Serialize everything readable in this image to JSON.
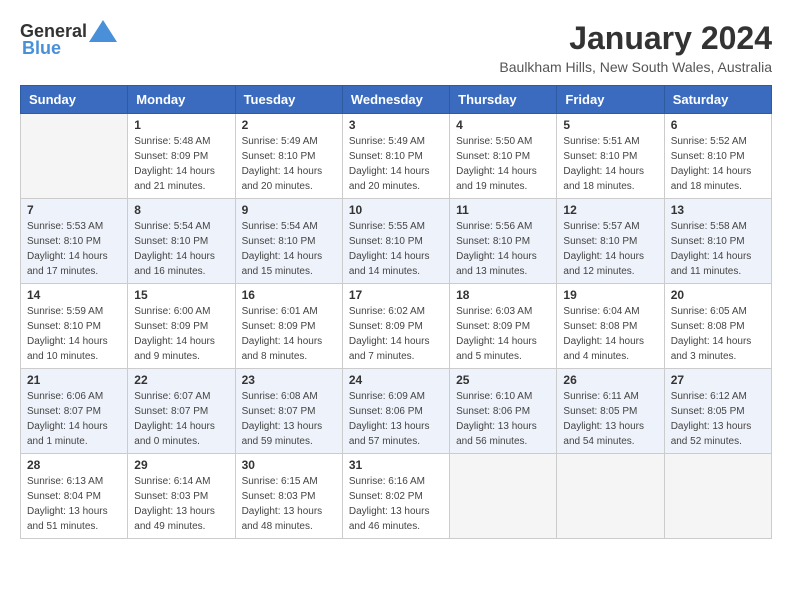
{
  "header": {
    "logo_general": "General",
    "logo_blue": "Blue",
    "month_title": "January 2024",
    "location": "Baulkham Hills, New South Wales, Australia"
  },
  "weekdays": [
    "Sunday",
    "Monday",
    "Tuesday",
    "Wednesday",
    "Thursday",
    "Friday",
    "Saturday"
  ],
  "weeks": [
    [
      {
        "day": "",
        "info": ""
      },
      {
        "day": "1",
        "info": "Sunrise: 5:48 AM\nSunset: 8:09 PM\nDaylight: 14 hours\nand 21 minutes."
      },
      {
        "day": "2",
        "info": "Sunrise: 5:49 AM\nSunset: 8:10 PM\nDaylight: 14 hours\nand 20 minutes."
      },
      {
        "day": "3",
        "info": "Sunrise: 5:49 AM\nSunset: 8:10 PM\nDaylight: 14 hours\nand 20 minutes."
      },
      {
        "day": "4",
        "info": "Sunrise: 5:50 AM\nSunset: 8:10 PM\nDaylight: 14 hours\nand 19 minutes."
      },
      {
        "day": "5",
        "info": "Sunrise: 5:51 AM\nSunset: 8:10 PM\nDaylight: 14 hours\nand 18 minutes."
      },
      {
        "day": "6",
        "info": "Sunrise: 5:52 AM\nSunset: 8:10 PM\nDaylight: 14 hours\nand 18 minutes."
      }
    ],
    [
      {
        "day": "7",
        "info": "Sunrise: 5:53 AM\nSunset: 8:10 PM\nDaylight: 14 hours\nand 17 minutes."
      },
      {
        "day": "8",
        "info": "Sunrise: 5:54 AM\nSunset: 8:10 PM\nDaylight: 14 hours\nand 16 minutes."
      },
      {
        "day": "9",
        "info": "Sunrise: 5:54 AM\nSunset: 8:10 PM\nDaylight: 14 hours\nand 15 minutes."
      },
      {
        "day": "10",
        "info": "Sunrise: 5:55 AM\nSunset: 8:10 PM\nDaylight: 14 hours\nand 14 minutes."
      },
      {
        "day": "11",
        "info": "Sunrise: 5:56 AM\nSunset: 8:10 PM\nDaylight: 14 hours\nand 13 minutes."
      },
      {
        "day": "12",
        "info": "Sunrise: 5:57 AM\nSunset: 8:10 PM\nDaylight: 14 hours\nand 12 minutes."
      },
      {
        "day": "13",
        "info": "Sunrise: 5:58 AM\nSunset: 8:10 PM\nDaylight: 14 hours\nand 11 minutes."
      }
    ],
    [
      {
        "day": "14",
        "info": "Sunrise: 5:59 AM\nSunset: 8:10 PM\nDaylight: 14 hours\nand 10 minutes."
      },
      {
        "day": "15",
        "info": "Sunrise: 6:00 AM\nSunset: 8:09 PM\nDaylight: 14 hours\nand 9 minutes."
      },
      {
        "day": "16",
        "info": "Sunrise: 6:01 AM\nSunset: 8:09 PM\nDaylight: 14 hours\nand 8 minutes."
      },
      {
        "day": "17",
        "info": "Sunrise: 6:02 AM\nSunset: 8:09 PM\nDaylight: 14 hours\nand 7 minutes."
      },
      {
        "day": "18",
        "info": "Sunrise: 6:03 AM\nSunset: 8:09 PM\nDaylight: 14 hours\nand 5 minutes."
      },
      {
        "day": "19",
        "info": "Sunrise: 6:04 AM\nSunset: 8:08 PM\nDaylight: 14 hours\nand 4 minutes."
      },
      {
        "day": "20",
        "info": "Sunrise: 6:05 AM\nSunset: 8:08 PM\nDaylight: 14 hours\nand 3 minutes."
      }
    ],
    [
      {
        "day": "21",
        "info": "Sunrise: 6:06 AM\nSunset: 8:07 PM\nDaylight: 14 hours\nand 1 minute."
      },
      {
        "day": "22",
        "info": "Sunrise: 6:07 AM\nSunset: 8:07 PM\nDaylight: 14 hours\nand 0 minutes."
      },
      {
        "day": "23",
        "info": "Sunrise: 6:08 AM\nSunset: 8:07 PM\nDaylight: 13 hours\nand 59 minutes."
      },
      {
        "day": "24",
        "info": "Sunrise: 6:09 AM\nSunset: 8:06 PM\nDaylight: 13 hours\nand 57 minutes."
      },
      {
        "day": "25",
        "info": "Sunrise: 6:10 AM\nSunset: 8:06 PM\nDaylight: 13 hours\nand 56 minutes."
      },
      {
        "day": "26",
        "info": "Sunrise: 6:11 AM\nSunset: 8:05 PM\nDaylight: 13 hours\nand 54 minutes."
      },
      {
        "day": "27",
        "info": "Sunrise: 6:12 AM\nSunset: 8:05 PM\nDaylight: 13 hours\nand 52 minutes."
      }
    ],
    [
      {
        "day": "28",
        "info": "Sunrise: 6:13 AM\nSunset: 8:04 PM\nDaylight: 13 hours\nand 51 minutes."
      },
      {
        "day": "29",
        "info": "Sunrise: 6:14 AM\nSunset: 8:03 PM\nDaylight: 13 hours\nand 49 minutes."
      },
      {
        "day": "30",
        "info": "Sunrise: 6:15 AM\nSunset: 8:03 PM\nDaylight: 13 hours\nand 48 minutes."
      },
      {
        "day": "31",
        "info": "Sunrise: 6:16 AM\nSunset: 8:02 PM\nDaylight: 13 hours\nand 46 minutes."
      },
      {
        "day": "",
        "info": ""
      },
      {
        "day": "",
        "info": ""
      },
      {
        "day": "",
        "info": ""
      }
    ]
  ]
}
